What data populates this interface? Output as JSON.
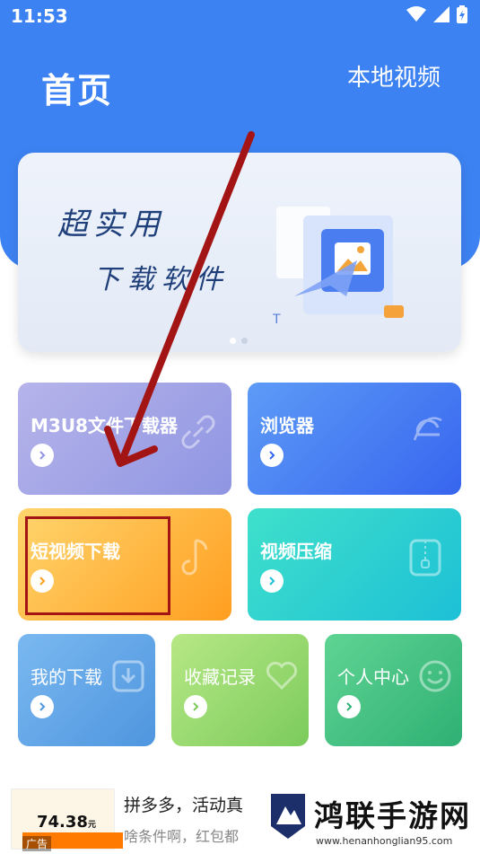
{
  "status_bar": {
    "time": "11:53"
  },
  "header": {
    "title": "首页",
    "local_video": "本地视频"
  },
  "banner": {
    "line1": "超实用",
    "line2": "下载软件"
  },
  "cards": {
    "m3u8": "M3U8文件下载器",
    "browser": "浏览器",
    "short_video": "短视频下载",
    "compress": "视频压缩",
    "my_downloads": "我的下载",
    "favorites": "收藏记录",
    "profile": "个人中心"
  },
  "ad": {
    "price": "74.38",
    "price_unit": "元",
    "title": "拼多多，活动真",
    "subtitle": "啥条件啊，红包都",
    "badge": "广告"
  },
  "watermark": {
    "title": "鸿联手游网",
    "url": "www.henanhonglian95.com"
  },
  "colors": {
    "header": "#3d82f2",
    "annotation": "#a31414"
  }
}
